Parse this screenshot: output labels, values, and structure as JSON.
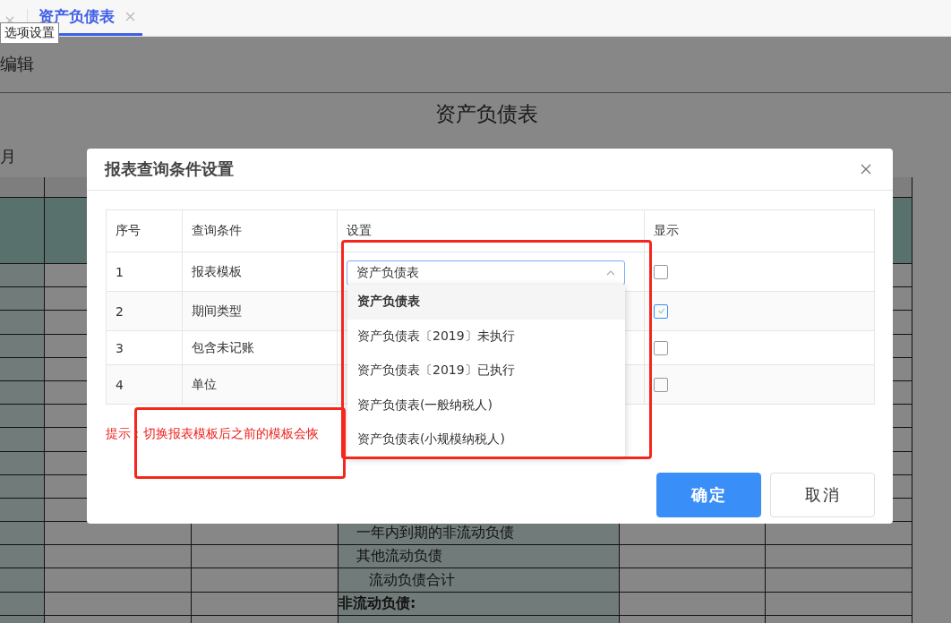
{
  "tabs": [
    {
      "label": "资产负债表",
      "selected": true
    }
  ],
  "tooltip": "选项设置",
  "toolbar": {
    "edit": "编辑"
  },
  "report": {
    "title": "资产负债表",
    "period_label": "月",
    "rows": [
      {
        "kind": "item",
        "text": "一年内到期的非流动负债"
      },
      {
        "kind": "item",
        "text": "其他流动负债"
      },
      {
        "kind": "total",
        "text": "流动负债合计"
      },
      {
        "kind": "section",
        "text": "非流动负债:"
      }
    ]
  },
  "dialog": {
    "title": "报表查询条件设置",
    "columns": [
      "序号",
      "查询条件",
      "设置",
      "显示"
    ],
    "rows": [
      {
        "index": "1",
        "condition": "报表模板",
        "shown": false
      },
      {
        "index": "2",
        "condition": "期间类型",
        "shown": true
      },
      {
        "index": "3",
        "condition": "包含未记账",
        "shown": false
      },
      {
        "index": "4",
        "condition": "单位",
        "shown": false
      }
    ],
    "select": {
      "value": "资产负债表",
      "expanded": true,
      "options": [
        {
          "label": "资产负债表",
          "selected": true
        },
        {
          "label": "资产负债表〔2019〕未执行",
          "selected": false
        },
        {
          "label": "资产负债表〔2019〕已执行",
          "selected": false
        },
        {
          "label": "资产负债表(一般纳税人)",
          "selected": false
        },
        {
          "label": "资产负债表(小规模纳税人)",
          "selected": false
        }
      ]
    },
    "hint": "提示：切换报表模板后之前的模板会恢",
    "buttons": [
      {
        "label": "确定",
        "kind": "primary"
      },
      {
        "label": "取消",
        "kind": "default"
      }
    ]
  }
}
